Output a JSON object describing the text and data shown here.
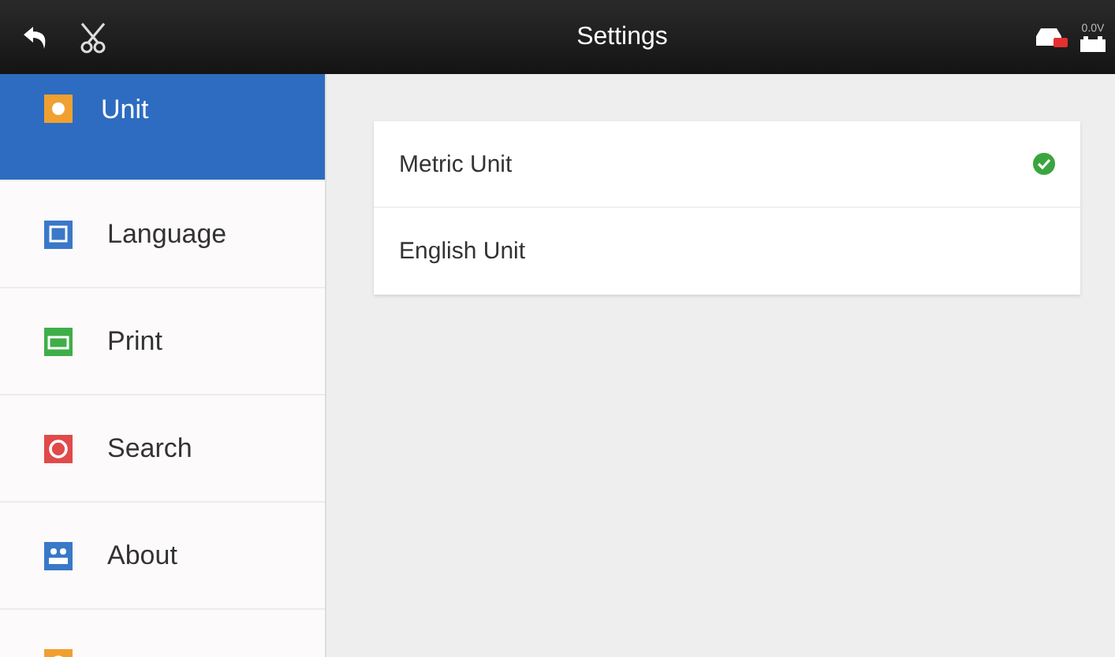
{
  "top_bar": {
    "title": "Settings",
    "voltage": "0.0V"
  },
  "sidebar": {
    "items": [
      {
        "label": "Unit",
        "selected": true,
        "color": "#f0a030",
        "kind": "unit"
      },
      {
        "label": "Language",
        "selected": false,
        "color": "#3a78c8",
        "kind": "language"
      },
      {
        "label": "Print",
        "selected": false,
        "color": "#3fae49",
        "kind": "print"
      },
      {
        "label": "Search",
        "selected": false,
        "color": "#e04a4a",
        "kind": "search"
      },
      {
        "label": "About",
        "selected": false,
        "color": "#3a78c8",
        "kind": "about"
      },
      {
        "selected": false,
        "color": "#f0a030",
        "kind": "system"
      }
    ]
  },
  "options": [
    {
      "label": "Metric Unit",
      "selected": true
    },
    {
      "label": "English Unit",
      "selected": false
    }
  ]
}
